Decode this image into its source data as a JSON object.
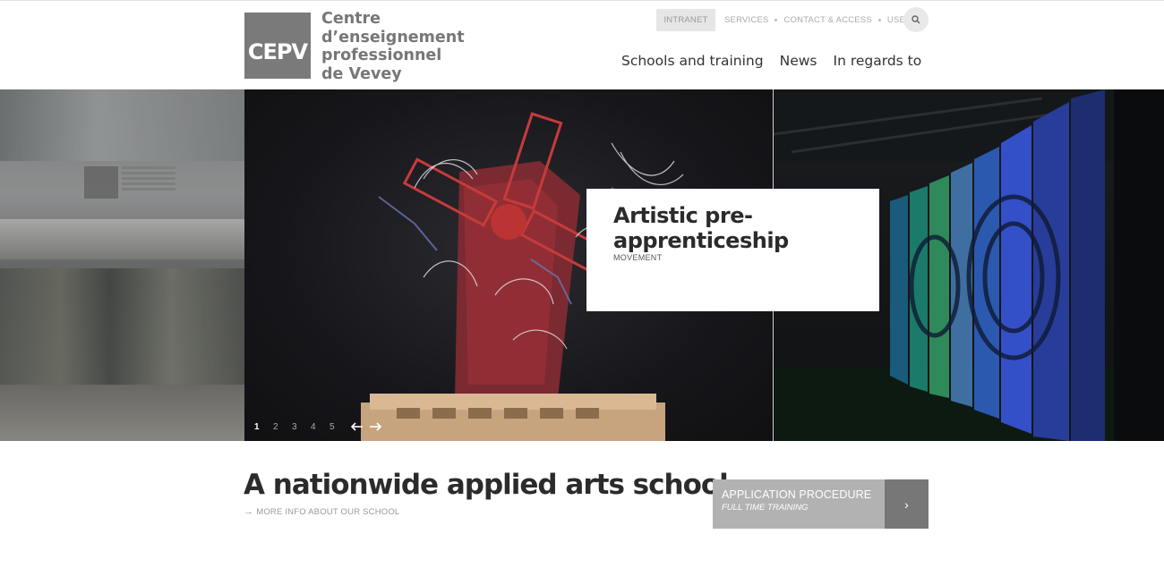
{
  "header": {
    "logo_text": "CEPV",
    "name_lines": [
      "Centre",
      "d’enseignement",
      "professionnel",
      "de Vevey"
    ],
    "utility": {
      "intranet_label": "INTRANET",
      "links": [
        "SERVICES",
        "CONTACT & ACCESS",
        "USE"
      ],
      "search_icon": "search-icon"
    },
    "nav": [
      "Schools and training",
      "News",
      "In regards to"
    ]
  },
  "hero": {
    "caption_title": "Artistic pre-apprenticeship",
    "caption_subtitle": "MOVEMENT",
    "pager": [
      "1",
      "2",
      "3",
      "4",
      "5"
    ],
    "active_page": "1",
    "prev_icon": "arrow-left-icon",
    "next_icon": "arrow-right-icon"
  },
  "main": {
    "tagline": "A nationwide applied arts school",
    "more_info_label": "MORE INFO ABOUT OUR SCHOOL",
    "apply": {
      "title": "APPLICATION PROCEDURE",
      "subtitle": "FULL TIME TRAINING",
      "chevron": "›"
    }
  },
  "colors": {
    "logo_bg": "#7a7a7a",
    "apply_bg": "#b2b2b2",
    "apply_arrow_bg": "#777777",
    "text_dark": "#2b2b2b"
  }
}
